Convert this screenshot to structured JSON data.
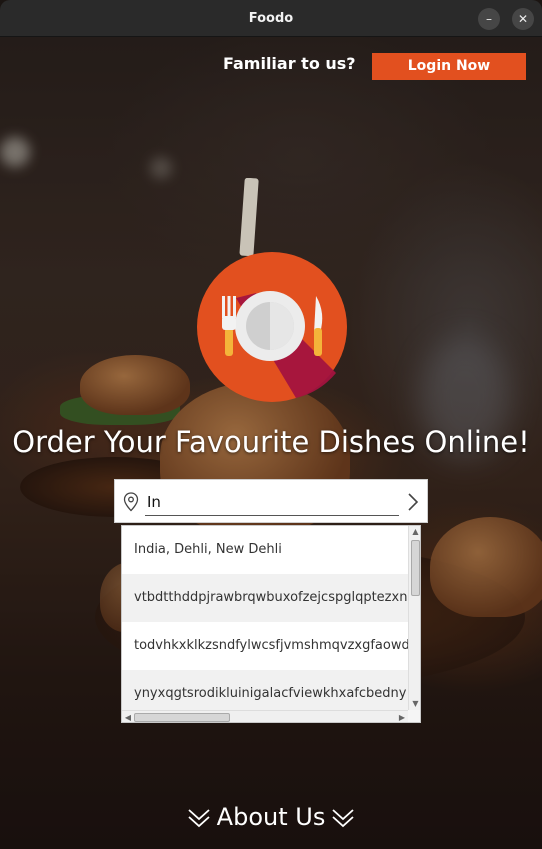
{
  "window": {
    "title": "Foodo",
    "minimize_glyph": "–",
    "close_glyph": "✕"
  },
  "header": {
    "prompt": "Familiar to us?",
    "login_label": "Login Now",
    "login_color": "#e2501f"
  },
  "logo": {
    "icon": "plate-fork-knife-logo",
    "circle_color": "#e2501f",
    "shadow_color": "#a3133f"
  },
  "headline": "Order Your Favourite Dishes Online!",
  "search": {
    "value": "In",
    "icons": [
      "location-pin-icon",
      "chevron-right-icon"
    ]
  },
  "suggestions": [
    "India, Dehli, New Dehli",
    "vtbdtthddpjrawbrqwbuxofzejcspglqptezxn",
    "todvhkxklkzsndfylwcsfjvmshmqvzxgfaowd",
    "ynyxqgtsrodikluinigalacfviewkhxafcbedny"
  ],
  "footer": {
    "about_label": "About Us",
    "icon": "double-chevron-down-icon"
  }
}
